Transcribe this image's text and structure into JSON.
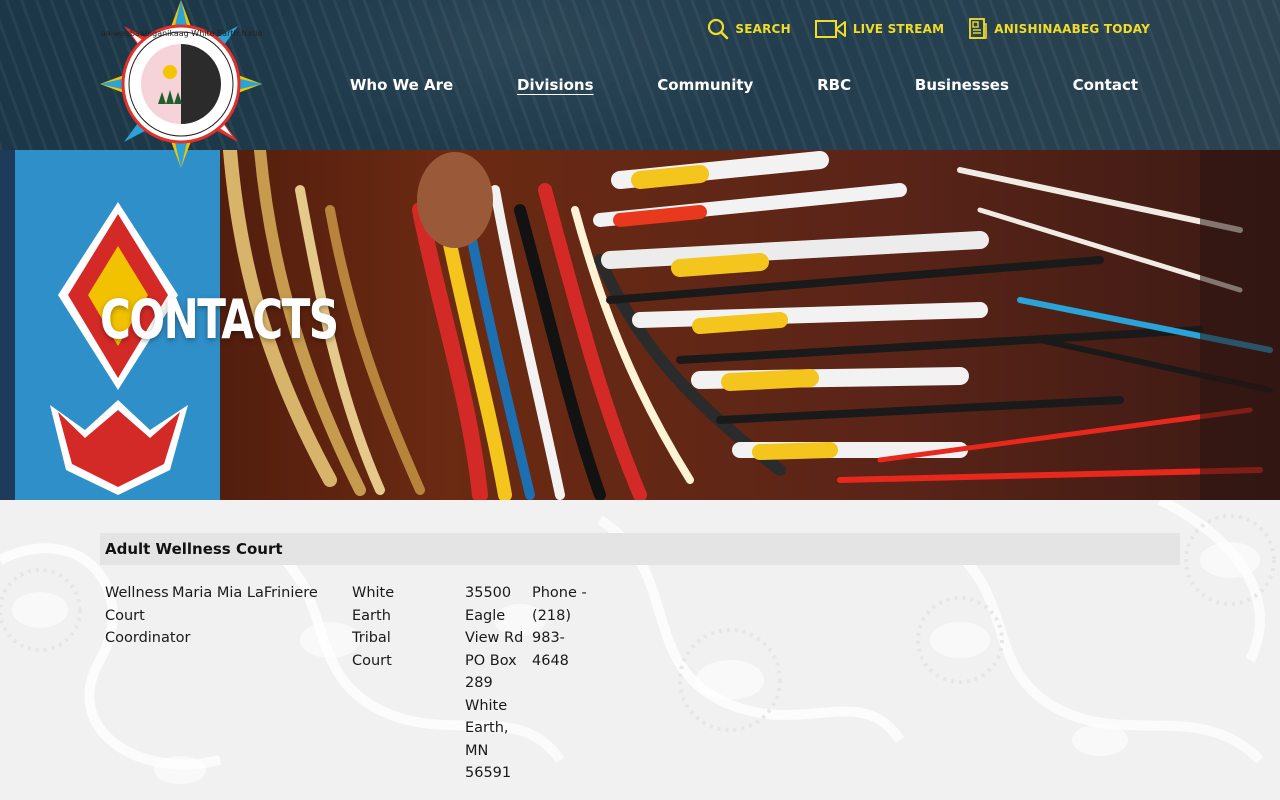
{
  "header": {
    "logo_text": "Gaa-waabaabiganikaag White Earth Nation",
    "utility_links": [
      {
        "label": "SEARCH",
        "icon": "search-icon"
      },
      {
        "label": "LIVE STREAM",
        "icon": "video-camera-icon"
      },
      {
        "label": "ANISHINAABEG TODAY",
        "icon": "newspaper-icon"
      }
    ],
    "nav": [
      {
        "label": "Who We Are",
        "active": false
      },
      {
        "label": "Divisions",
        "active": true
      },
      {
        "label": "Community",
        "active": false
      },
      {
        "label": "RBC",
        "active": false
      },
      {
        "label": "Businesses",
        "active": false
      },
      {
        "label": "Contact",
        "active": false
      }
    ],
    "colors": {
      "bar": "#1f3b4c",
      "utility_text": "#f1dc2a",
      "nav_text": "#ffffff"
    }
  },
  "hero": {
    "title": "CONTACTS"
  },
  "section": {
    "title": "Adult Wellness Court",
    "contact": {
      "title": "Wellness Court Coordinator",
      "name": "Maria Mia LaFriniere",
      "organization": "White Earth Tribal Court",
      "address": "35500 Eagle View Rd PO Box 289 White Earth, MN 56591",
      "phone": "Phone - (218) 983-4648"
    }
  }
}
